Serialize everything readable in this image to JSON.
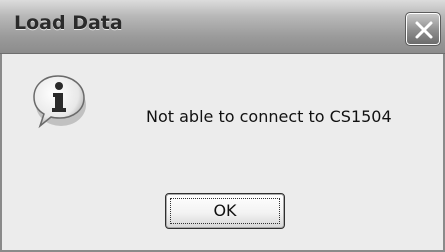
{
  "window": {
    "title": "Load Data"
  },
  "dialog": {
    "icon": "information-icon",
    "message": "Not able to connect to CS1504",
    "ok_label": "OK"
  },
  "colors": {
    "titlebar": "#9a9a9a",
    "window_background": "#ececec",
    "text": "#111111"
  }
}
